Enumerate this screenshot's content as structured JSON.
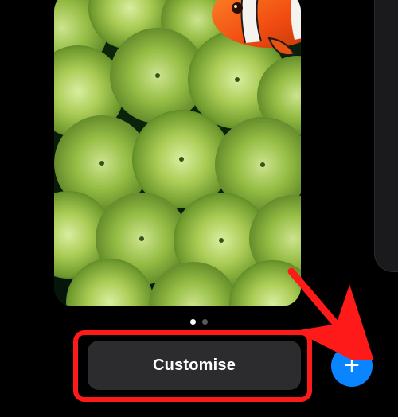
{
  "wallpaper": {
    "semantic_name": "clownfish-anemone-wallpaper"
  },
  "page_indicator": {
    "count": 2,
    "active_index": 0
  },
  "buttons": {
    "customise_label": "Customise",
    "add_label": "+"
  },
  "colors": {
    "accent_blue": "#0a84ff",
    "annotation_red": "#ff1a1a",
    "button_bg": "#2c2c2e"
  },
  "annotations": {
    "has_highlight_rect": true,
    "has_arrow": true
  }
}
